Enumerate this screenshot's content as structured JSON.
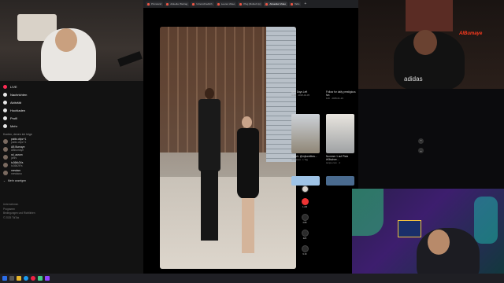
{
  "sidebar": {
    "nav": [
      {
        "label": "LIVE",
        "icon": "live-icon",
        "color": "#fe2c55"
      },
      {
        "label": "Nachrichten",
        "icon": "message-icon",
        "color": "#e6e6e6"
      },
      {
        "label": "Aktivität",
        "icon": "bell-icon",
        "color": "#e6e6e6"
      },
      {
        "label": "Hochladen",
        "icon": "upload-icon",
        "color": "#e6e6e6"
      },
      {
        "label": "Profil",
        "icon": "profile-icon",
        "color": "#e6e6e6"
      },
      {
        "label": "Mehr",
        "icon": "more-icon",
        "color": "#e6e6e6"
      }
    ],
    "following_label": "Konten, denen ich folge",
    "following": [
      {
        "name": "pablo.clipz+1",
        "sub": "pablo.clipz+1"
      },
      {
        "name": "AB Bumaye",
        "sub": "ABbumaye"
      },
      {
        "name": "xd_aurum",
        "sub": "jahrs"
      },
      {
        "name": "tu36tik3Ya",
        "sub": "tu36ti2iFa"
      },
      {
        "name": "mewtwo",
        "sub": "mewtwoo"
      }
    ],
    "show_more": "Mehr anzeigen",
    "footer": [
      "Unternehmen",
      "Programm",
      "Bedingungen und Richtlinien",
      "© 2025 TikTok"
    ]
  },
  "browser": {
    "tabs": [
      "Pinnwand",
      "Aktueller Beitrag",
      "Unterschiedlich",
      "Leeres Video",
      "Plug (Rolled Up)",
      "Aktuelles Video",
      "Tabs"
    ],
    "active_tab": 5
  },
  "video": {
    "actions": [
      {
        "name": "creator-avatar",
        "count": ""
      },
      {
        "name": "like-button",
        "count": "1.2M"
      },
      {
        "name": "comment-button",
        "count": "4.8K"
      },
      {
        "name": "bookmark-button",
        "count": "22K"
      },
      {
        "name": "share-button",
        "count": "9.1K"
      }
    ]
  },
  "suggestions": [
    {
      "title": "Und Days Left",
      "meta": "4.2M · 2025-02-05"
    },
    {
      "title": "Follow for daily prestigious fun",
      "meta": "12K · 2025-01-19"
    },
    {
      "title": "Twitch: @mjhamllkes...",
      "meta": "nekitsimit · 1 Tag"
    },
    {
      "title": "Nummer 1 auf Platz #Klischee...",
      "meta": "tempo.com · 4"
    }
  ],
  "overlay": {
    "brand": "AlBumaye"
  },
  "colors": {
    "accent": "#fe2c55",
    "taskbar": "#1f1f24"
  }
}
